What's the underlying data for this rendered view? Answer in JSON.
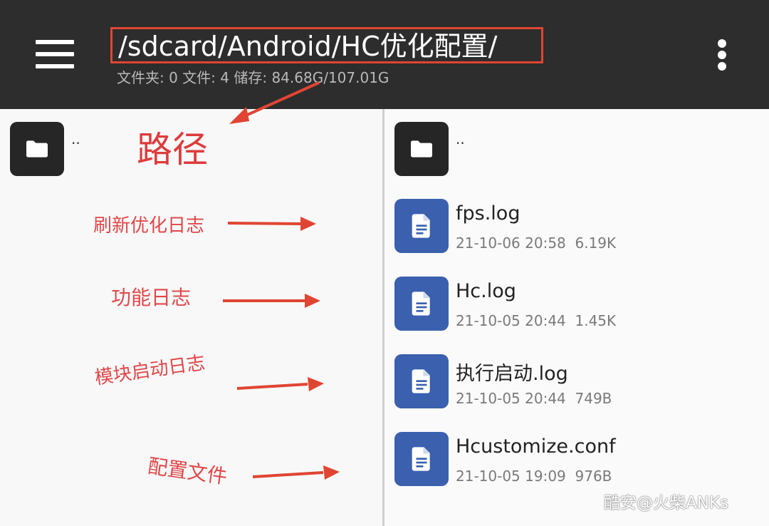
{
  "toolbar": {
    "path": "/sdcard/Android/HC优化配置/",
    "info": "文件夹: 0   文件: 4   储存: 84.68G/107.01G",
    "menu_icon": "hamburger-menu-icon",
    "overflow_icon": "more-vert-icon"
  },
  "left_pane": {
    "parent_label": ".."
  },
  "right_pane": {
    "parent_label": "..",
    "files": [
      {
        "name": "fps.log",
        "date": "21-10-06 20:58",
        "size": "6.19K",
        "icon": "document-icon"
      },
      {
        "name": "Hc.log",
        "date": "21-10-05 20:44",
        "size": "1.45K",
        "icon": "document-icon"
      },
      {
        "name": "执行启动.log",
        "date": "21-10-05 20:44",
        "size": "749B",
        "icon": "document-icon"
      },
      {
        "name": "Hcustomize.conf",
        "date": "21-10-05 19:09",
        "size": "976B",
        "icon": "document-icon"
      }
    ]
  },
  "annotations": {
    "path": "路径",
    "refresh_log": "刷新优化日志",
    "function_log": "功能日志",
    "module_log": "模块启动日志",
    "config_file": "配置文件"
  },
  "watermark": "酷安@火柴ANKs",
  "colors": {
    "toolbar_bg": "#2d2d2d",
    "file_icon_bg": "#3a60ae",
    "folder_icon_bg": "#262626",
    "annotation_red": "#e04533"
  }
}
